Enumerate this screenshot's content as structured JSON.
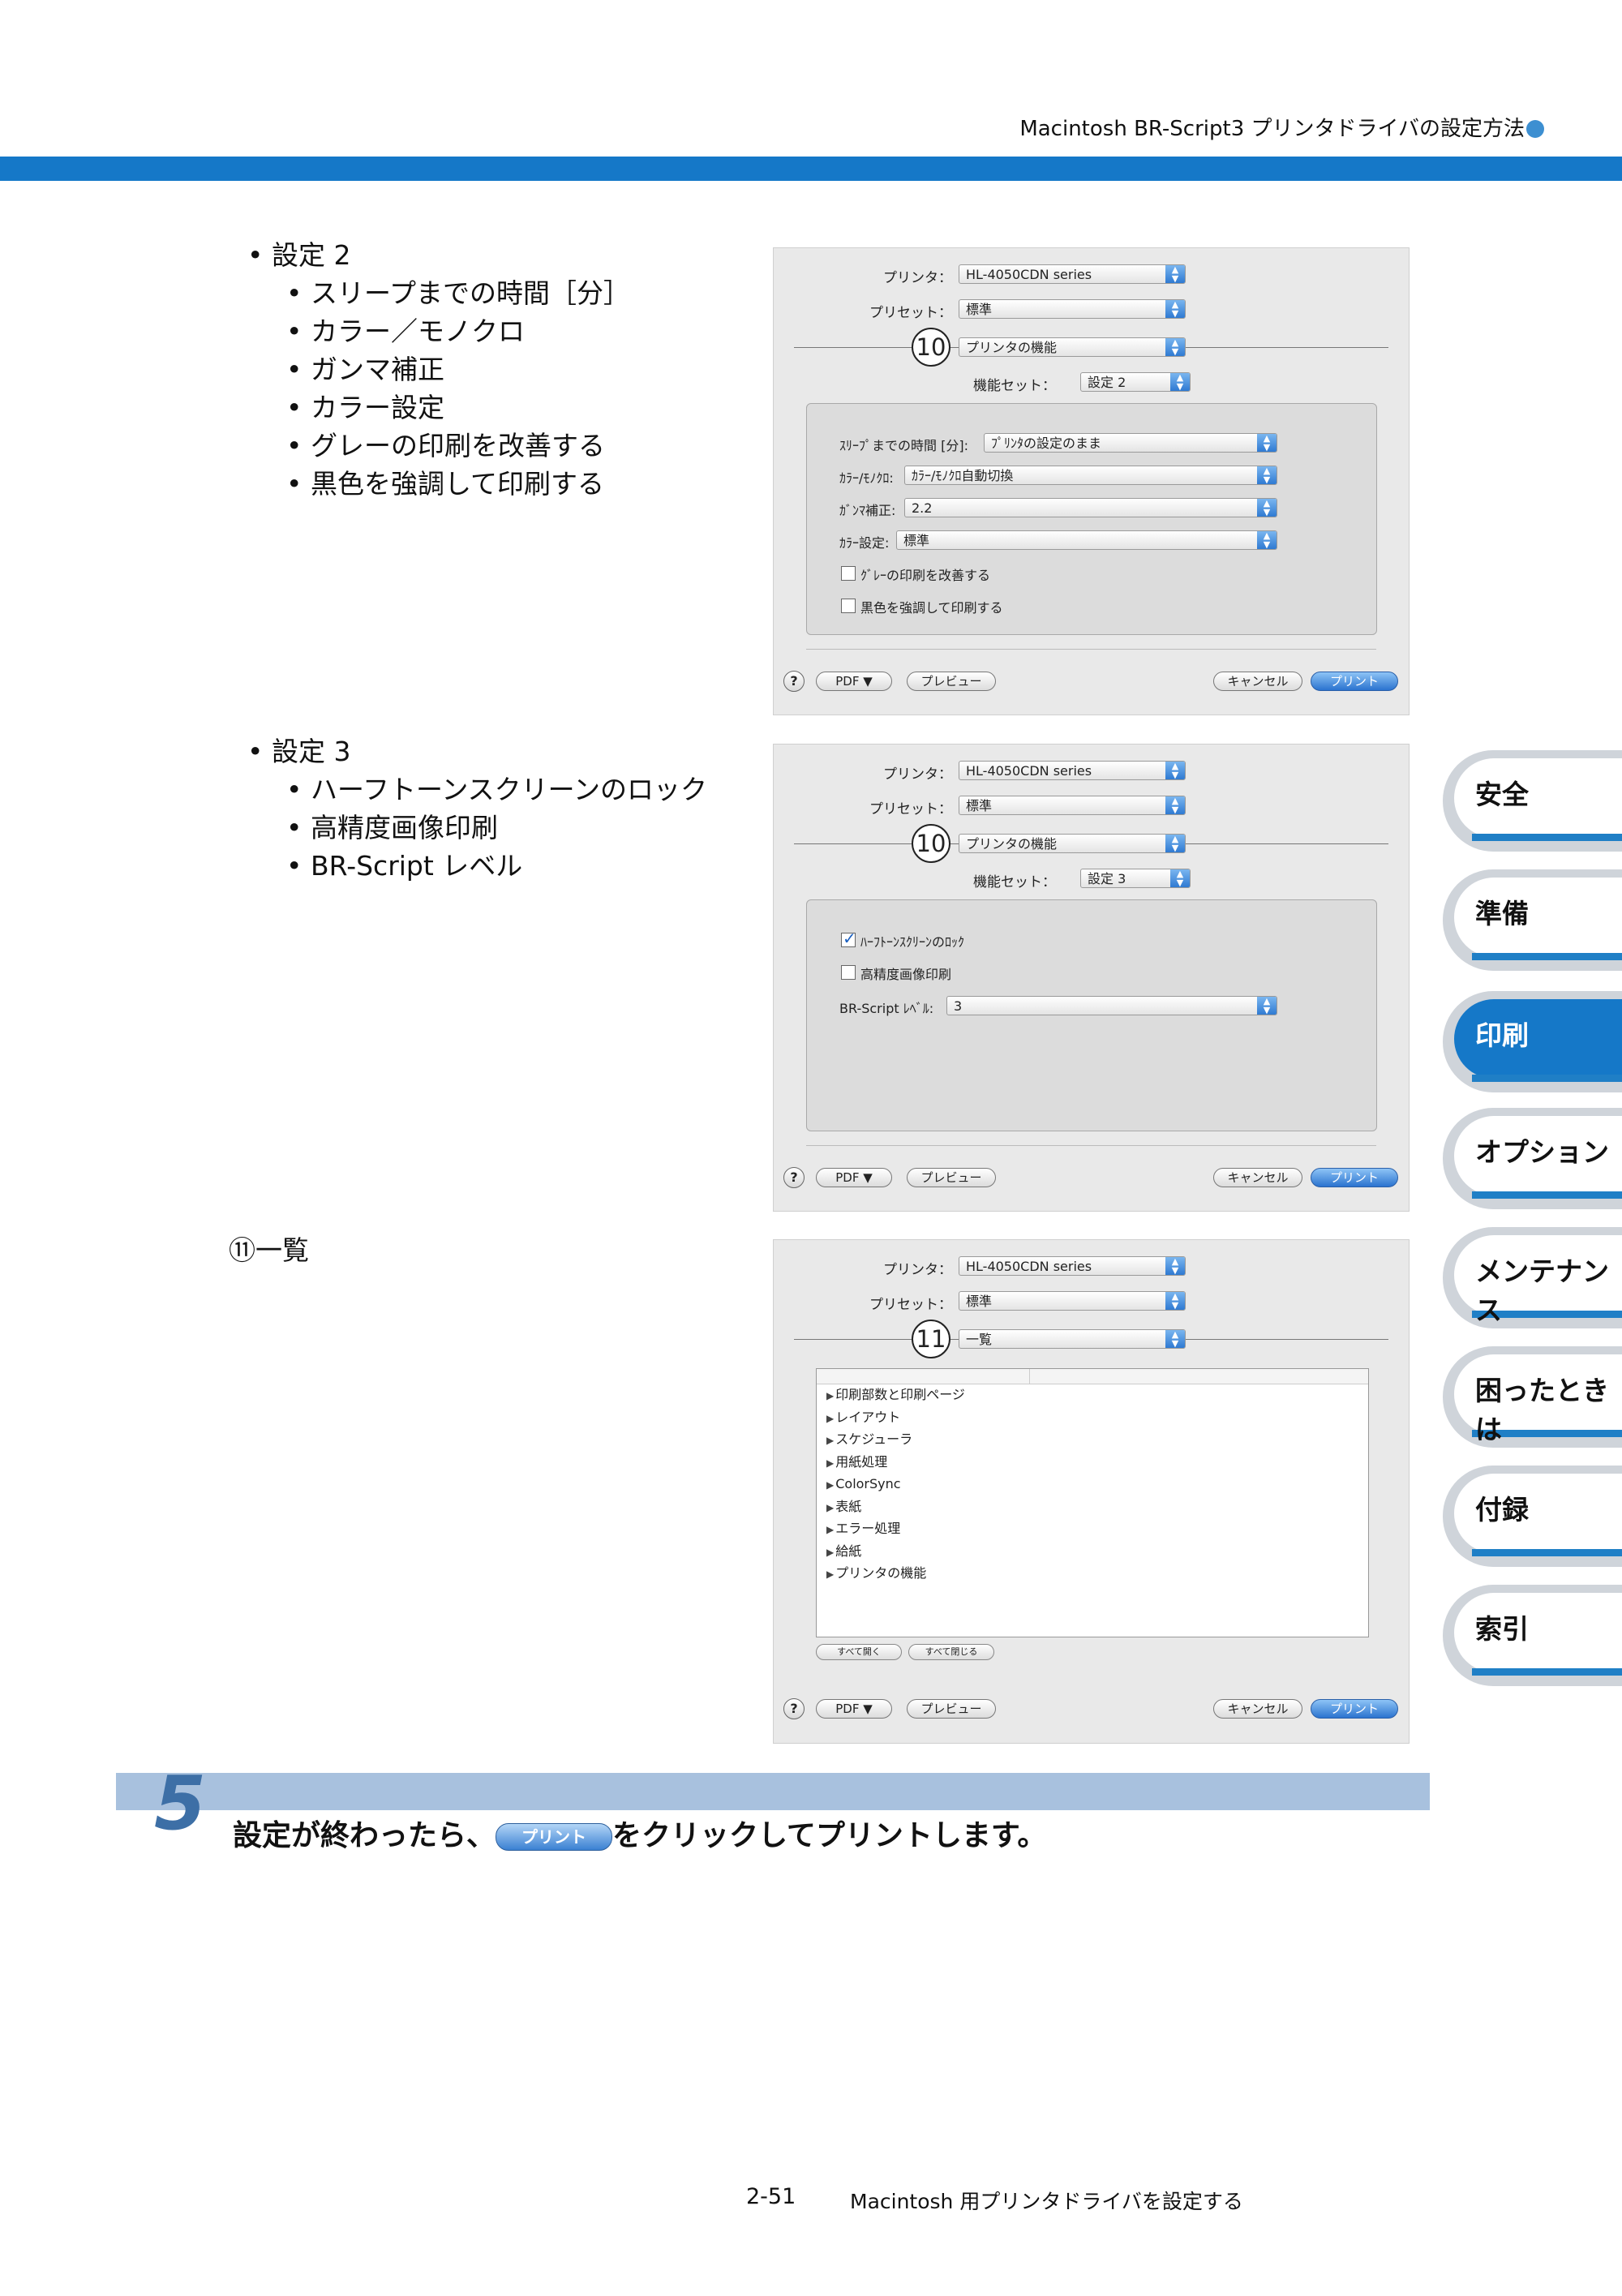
{
  "header": {
    "title": "Macintosh BR-Script3 プリンタドライバの設定方法"
  },
  "section2": {
    "heading": "設定 2",
    "items": [
      "スリープまでの時間［分］",
      "カラー／モノクロ",
      "ガンマ補正",
      "カラー設定",
      "グレーの印刷を改善する",
      "黒色を強調して印刷する"
    ]
  },
  "section3": {
    "heading": "設定 3",
    "items": [
      "ハーフトーンスクリーンのロック",
      "高精度画像印刷",
      "BR-Script レベル"
    ]
  },
  "section11": {
    "label": "⑪一覧"
  },
  "dialog_common": {
    "printer_label": "プリンタ：",
    "printer_value": "HL-4050CDN series",
    "preset_label": "プリセット：",
    "preset_value": "標準",
    "feature_set_label": "機能セット：",
    "help": "?",
    "pdf": "PDF ▼",
    "preview": "プレビュー",
    "cancel": "キャンセル",
    "print": "プリント"
  },
  "dialog1": {
    "callout": "10",
    "panel_value": "プリンタの機能",
    "feature_set_value": "設定 2",
    "rows": [
      {
        "label": "ｽﾘｰﾌﾟまでの時間 [分]:",
        "value": "ﾌﾟﾘﾝﾀの設定のまま"
      },
      {
        "label": "ｶﾗｰ/ﾓﾉｸﾛ:",
        "value": "ｶﾗｰ/ﾓﾉｸﾛ自動切換"
      },
      {
        "label": "ｶﾞﾝﾏ補正:",
        "value": "2.2"
      },
      {
        "label": "ｶﾗｰ設定:",
        "value": "標準"
      }
    ],
    "checks": [
      "ｸﾞﾚｰの印刷を改善する",
      "黒色を強調して印刷する"
    ]
  },
  "dialog2": {
    "callout": "10",
    "panel_value": "プリンタの機能",
    "feature_set_value": "設定 3",
    "checks": [
      "ﾊｰﾌﾄｰﾝｽｸﾘｰﾝのﾛｯｸ",
      "高精度画像印刷"
    ],
    "level_label": "BR-Script ﾚﾍﾞﾙ:",
    "level_value": "3"
  },
  "dialog3": {
    "callout": "11",
    "panel_value": "一覧",
    "list": [
      "印刷部数と印刷ページ",
      "レイアウト",
      "スケジューラ",
      "用紙処理",
      "ColorSync",
      "表紙",
      "エラー処理",
      "給紙",
      "プリンタの機能"
    ],
    "expand_all": "すべて開く",
    "collapse_all": "すべて閉じる"
  },
  "tabs": [
    {
      "label": "安全",
      "active": false
    },
    {
      "label": "準備",
      "active": false
    },
    {
      "label": "印刷",
      "active": true
    },
    {
      "label": "オプション",
      "active": false
    },
    {
      "label": "メンテナンス",
      "active": false
    },
    {
      "label": "困ったときは",
      "active": false
    },
    {
      "label": "付録",
      "active": false
    },
    {
      "label": "索引",
      "active": false
    }
  ],
  "step": {
    "number": "5",
    "text_before": "設定が終わったら、",
    "button": "プリント",
    "text_after": "をクリックしてプリントします。"
  },
  "footer": {
    "page": "2-51",
    "title": "Macintosh 用プリンタドライバを設定する"
  },
  "colors": {
    "accent": "#1578c8",
    "step_bar": "#a8c1de"
  }
}
